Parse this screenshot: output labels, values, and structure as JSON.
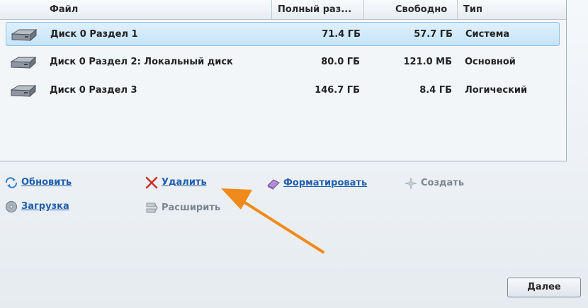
{
  "columns": {
    "file": "Файл",
    "total": "Полный раз...",
    "free": "Свободно",
    "type": "Тип"
  },
  "partitions": [
    {
      "name": "Диск 0 Раздел 1",
      "total": "71.4 ГБ",
      "free": "57.7 ГБ",
      "type": "Система",
      "selected": true
    },
    {
      "name": "Диск 0 Раздел 2: Локальный диск",
      "total": "80.0 ГБ",
      "free": "121.0 МБ",
      "type": "Основной",
      "selected": false
    },
    {
      "name": "Диск 0 Раздел 3",
      "total": "146.7 ГБ",
      "free": "8.4 ГБ",
      "type": "Логический",
      "selected": false
    }
  ],
  "actions": {
    "refresh": "Обновить",
    "delete": "Удалить",
    "format": "Форматировать",
    "create": "Создать",
    "load": "Загрузка",
    "extend": "Расширить"
  },
  "next_button": "Далее",
  "colors": {
    "link": "#1f5fae",
    "selected_row": "#c6e4f8",
    "annotation_arrow": "#f08a1c"
  },
  "icons": [
    "disk-icon",
    "refresh-icon",
    "delete-x-icon",
    "format-eraser-icon",
    "create-sparkle-icon",
    "load-disc-icon",
    "extend-icon"
  ]
}
